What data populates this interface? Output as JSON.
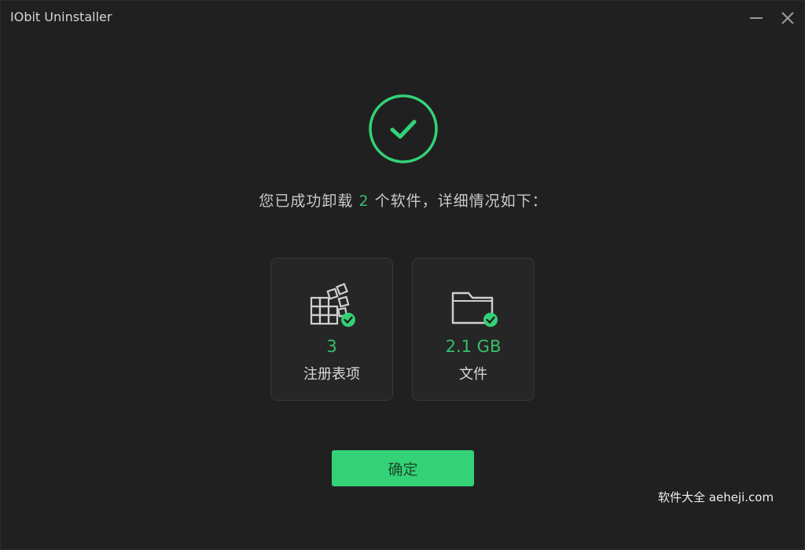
{
  "window": {
    "title": "IObit Uninstaller"
  },
  "summary": {
    "prefix": "您已成功卸载 ",
    "count": "2",
    "suffix": " 个软件，详细情况如下："
  },
  "cards": [
    {
      "icon": "registry-icon",
      "value": "3",
      "label": "注册表项"
    },
    {
      "icon": "folder-icon",
      "value": "2.1 GB",
      "label": "文件"
    }
  ],
  "actions": {
    "ok_label": "确定"
  },
  "watermark": "软件大全 aeheji.com",
  "colors": {
    "accent": "#33d276",
    "accent_text": "#36c06b",
    "background": "#202020",
    "card_bg": "#262626"
  }
}
